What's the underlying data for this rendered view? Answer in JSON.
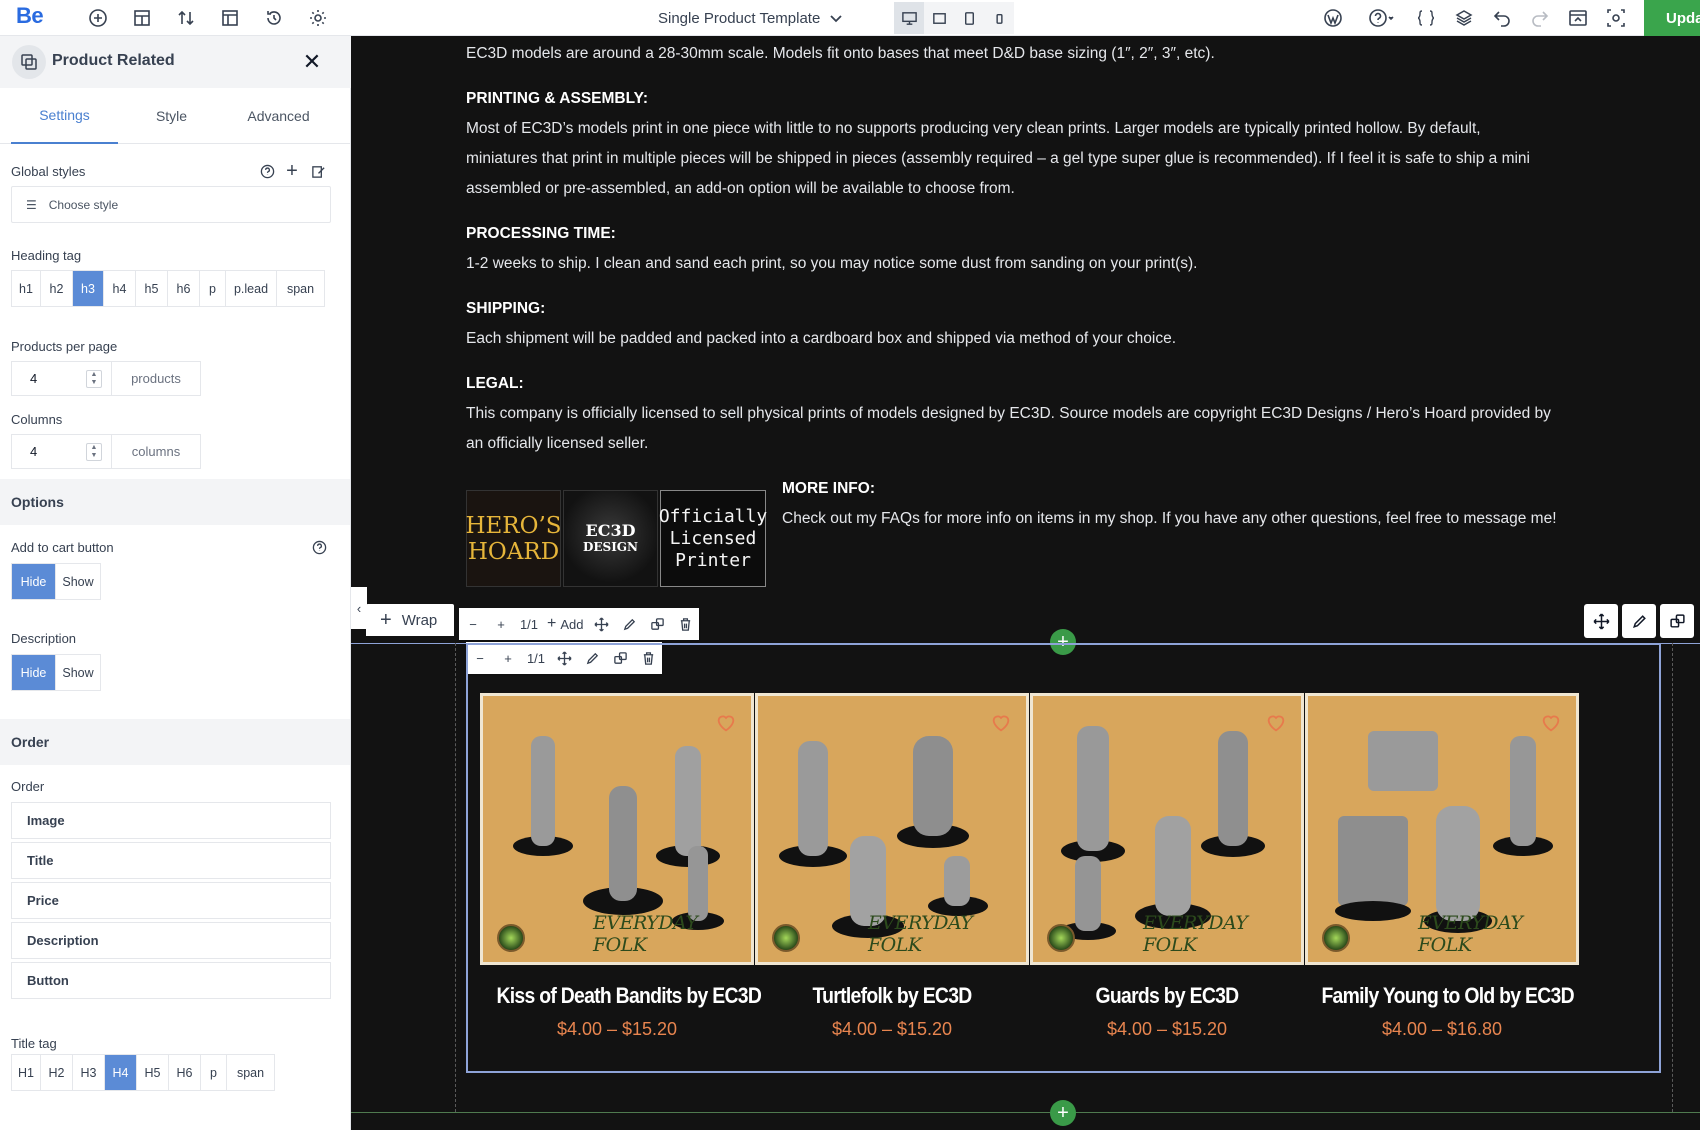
{
  "topbar": {
    "logo": "Be",
    "template_title": "Single Product Template",
    "update_label": "Upda"
  },
  "sidebar": {
    "title": "Product Related",
    "tabs": [
      "Settings",
      "Style",
      "Advanced"
    ],
    "global_styles_label": "Global styles",
    "choose_style": "Choose style",
    "heading_tag_label": "Heading tag",
    "heading_tags": [
      "h1",
      "h2",
      "h3",
      "h4",
      "h5",
      "h6",
      "p",
      "p.lead",
      "span"
    ],
    "heading_tag_selected": "h3",
    "products_per_page_label": "Products per page",
    "products_per_page_value": "4",
    "products_unit": "products",
    "columns_label": "Columns",
    "columns_value": "4",
    "columns_unit": "columns",
    "options_label": "Options",
    "add_to_cart_label": "Add to cart button",
    "add_to_cart_options": [
      "Hide",
      "Show"
    ],
    "add_to_cart_selected": "Hide",
    "description_label": "Description",
    "description_options": [
      "Hide",
      "Show"
    ],
    "description_selected": "Hide",
    "order_section_label": "Order",
    "order_label": "Order",
    "order_items": [
      "Image",
      "Title",
      "Price",
      "Description",
      "Button"
    ],
    "title_tag_label": "Title tag",
    "title_tags": [
      "H1",
      "H2",
      "H3",
      "H4",
      "H5",
      "H6",
      "p",
      "span"
    ],
    "title_tag_selected": "H4"
  },
  "content": {
    "intro": "EC3D models are around a 28-30mm scale. Models fit onto bases that meet D&D base sizing (1″, 2″, 3″, etc).",
    "printing_head": "PRINTING & ASSEMBLY:",
    "printing_l1": "Most of EC3D’s models print in one piece with little to no supports producing very clean prints. Larger models are typically printed hollow. By default,",
    "printing_l2": "miniatures that print in multiple pieces will be shipped in pieces (assembly required – a gel type super glue is recommended). If I feel it is safe to ship a mini",
    "printing_l3": "assembled or pre-assembled, an add-on option will be available to choose from.",
    "processing_head": "PROCESSING TIME:",
    "processing_text": "1-2 weeks to ship. I clean and sand each print, so you may notice some dust from sanding on your print(s).",
    "shipping_head": "SHIPPING:",
    "shipping_text": "Each shipment will be padded and packed into a cardboard box and shipped via method of your choice.",
    "legal_head": "LEGAL:",
    "legal_l1": "This company is officially licensed to sell physical prints of models designed by EC3D. Source models are copyright EC3D Designs / Hero’s Hoard provided by",
    "legal_l2": "an officially licensed seller.",
    "more_head": "MORE INFO:",
    "more_text": "Check out my FAQs for more info on items in my shop. If you have any other questions, feel free to message me!",
    "logo_heros": [
      "HERO’S",
      "HOARD"
    ],
    "logo_ec3d": [
      "EC3D",
      "DESIGN"
    ],
    "logo_licensed": [
      "Officially",
      "Licensed",
      "Printer"
    ]
  },
  "builder": {
    "wrap_label": "Wrap",
    "add_label": "Add",
    "ratio_label": "1/1"
  },
  "products": [
    {
      "title": "Kiss of Death Bandits by EC3D",
      "price": "$4.00 – $15.20",
      "brand": "EVERYDAY FOLK"
    },
    {
      "title": "Turtlefolk by EC3D",
      "price": "$4.00 – $15.20",
      "brand": "EVERYDAY FOLK"
    },
    {
      "title": "Guards by EC3D",
      "price": "$4.00 – $15.20",
      "brand": "EVERYDAY FOLK"
    },
    {
      "title": "Family Young to Old by EC3D",
      "price": "$4.00 – $16.80",
      "brand": "EVERYDAY FOLK"
    }
  ],
  "colors": {
    "accent": "#5b8bd6",
    "price": "#e8854f",
    "update_green": "#3aa54c",
    "canvas_bg": "#121212"
  }
}
